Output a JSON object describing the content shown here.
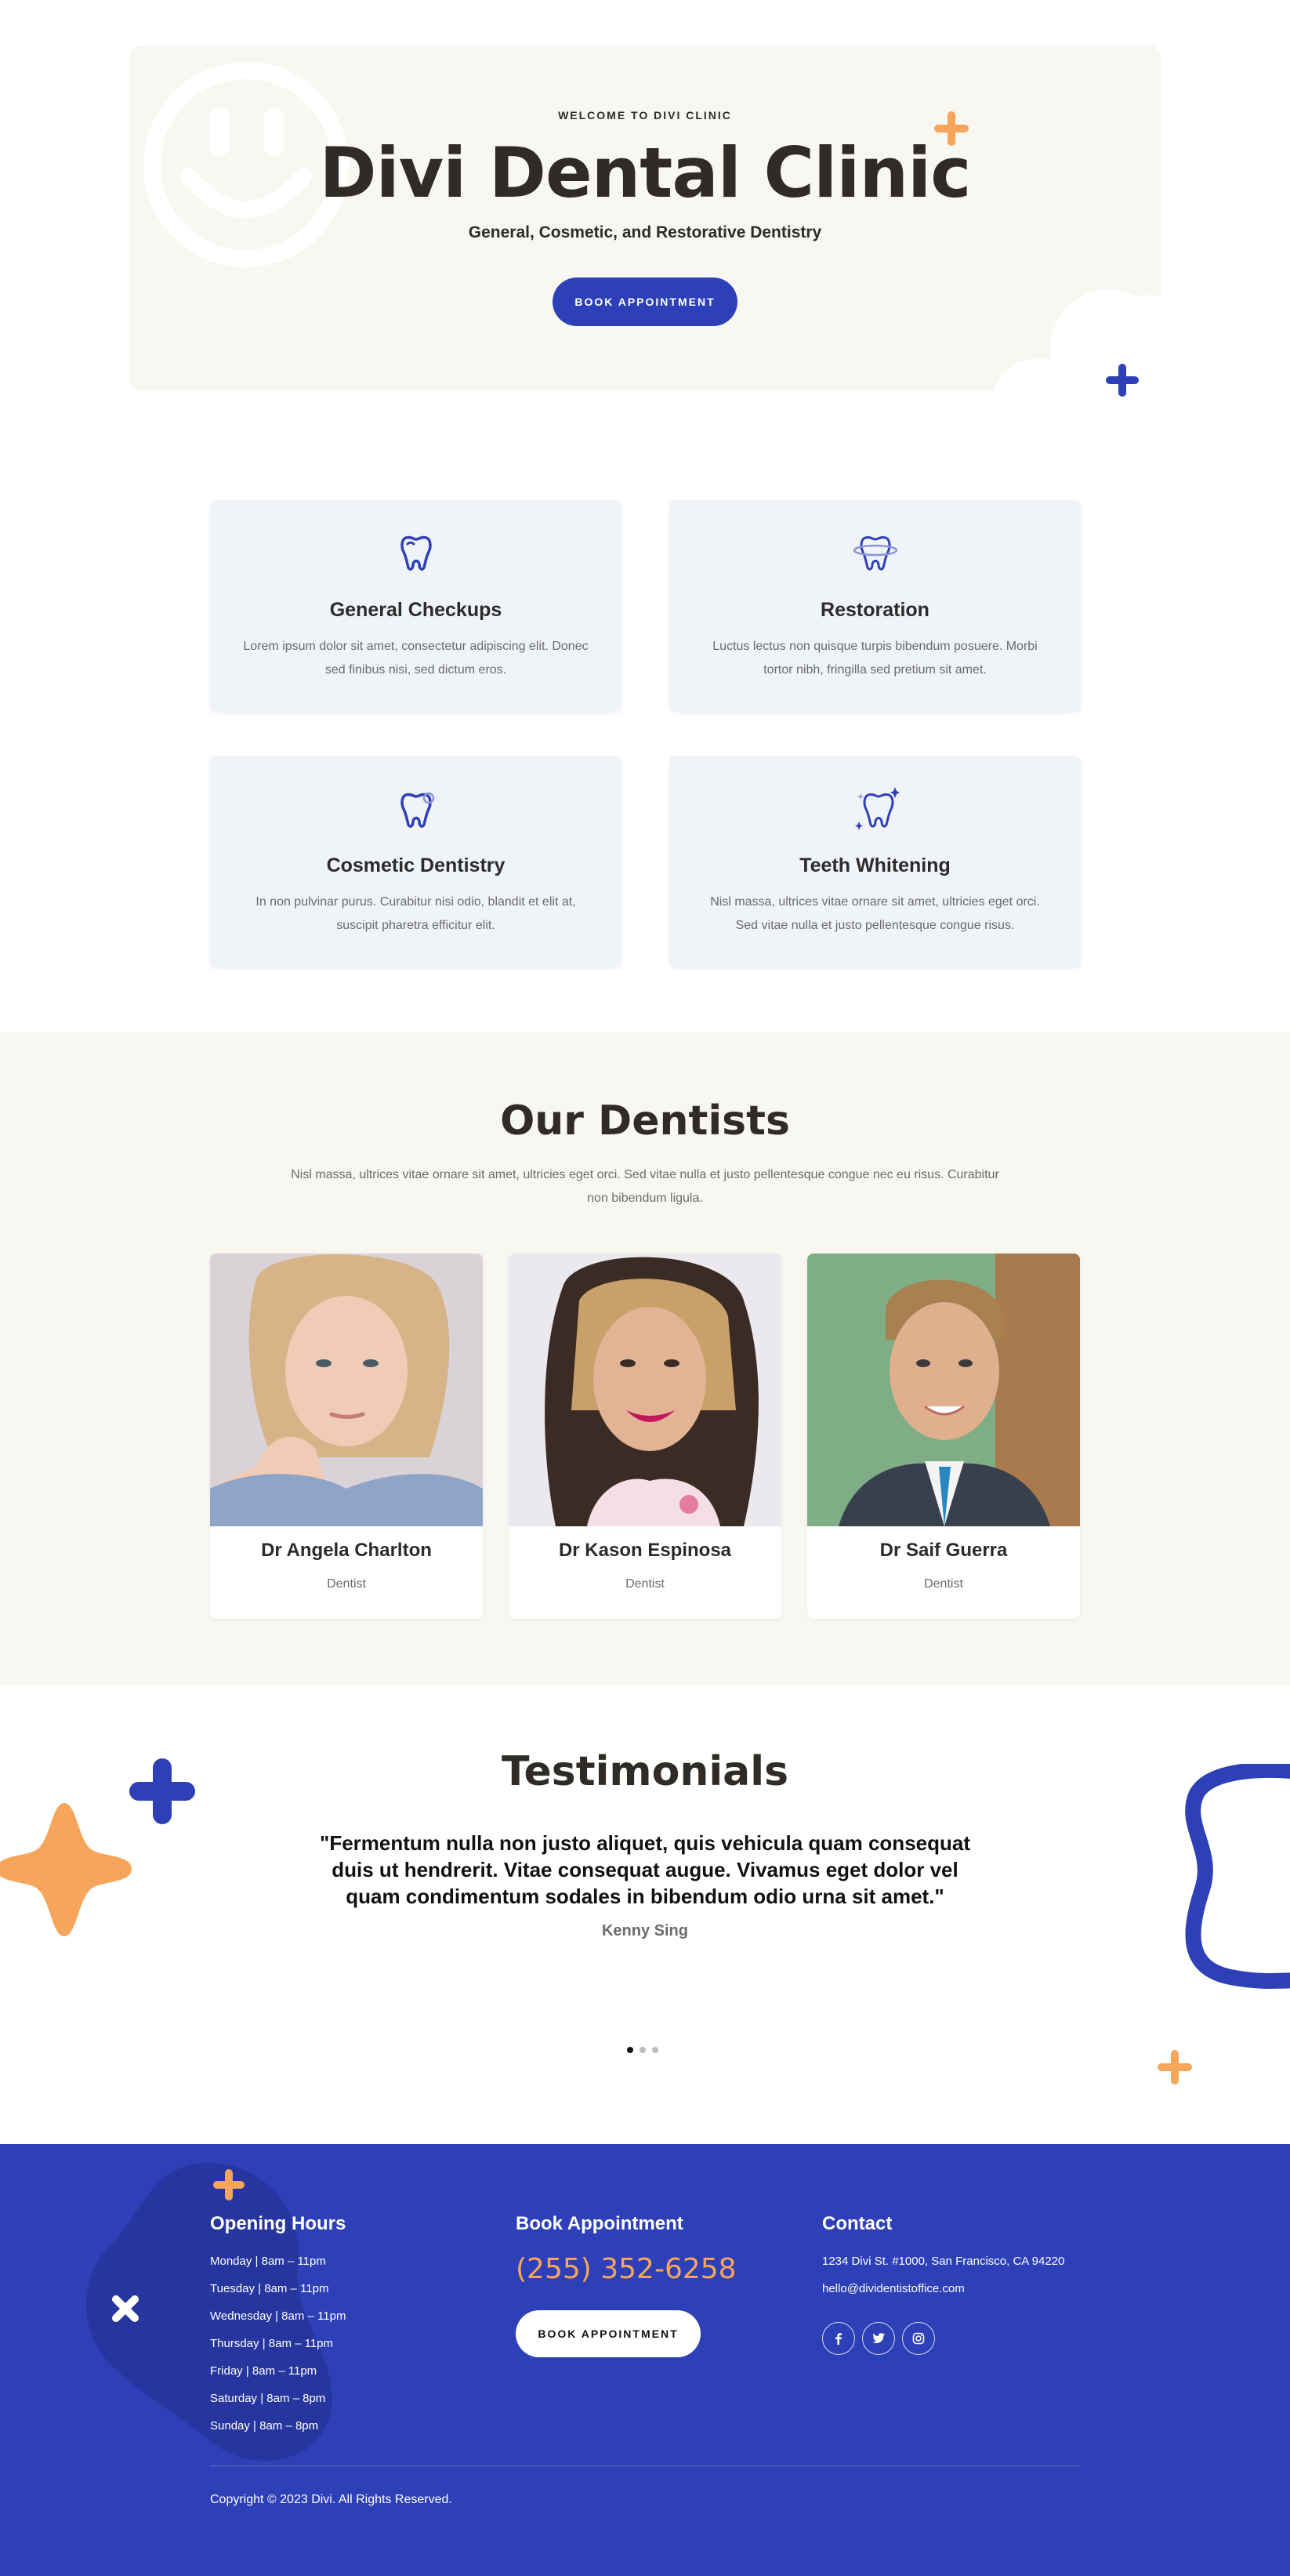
{
  "hero": {
    "eyebrow": "WELCOME TO DIVI CLINIC",
    "title": "Divi Dental Clinic",
    "subtitle": "General, Cosmetic, and Restorative Dentistry",
    "cta_label": "BOOK APPOINTMENT"
  },
  "services": [
    {
      "icon": "tooth-icon",
      "title": "General Checkups",
      "desc": "Lorem ipsum dolor sit amet, consectetur adipiscing elit. Donec sed finibus nisi, sed dictum eros."
    },
    {
      "icon": "tooth-restoration-icon",
      "title": "Restoration",
      "desc": "Luctus lectus non quisque turpis bibendum posuere. Morbi tortor nibh, fringilla sed pretium sit amet."
    },
    {
      "icon": "tooth-cosmetic-icon",
      "title": "Cosmetic Dentistry",
      "desc": "In non pulvinar purus. Curabitur nisi odio, blandit et elit at, suscipit pharetra efficitur elit."
    },
    {
      "icon": "tooth-sparkle-icon",
      "title": "Teeth Whitening",
      "desc": "Nisl massa, ultrices vitae ornare sit amet, ultricies eget orci. Sed vitae nulla et justo pellentesque congue risus."
    }
  ],
  "dentists": {
    "title": "Our Dentists",
    "desc": "Nisl massa, ultrices vitae ornare sit amet, ultricies eget orci. Sed vitae nulla et justo pellentesque congue nec eu risus. Curabitur non bibendum ligula.",
    "items": [
      {
        "name": "Dr Angela Charlton",
        "role": "Dentist"
      },
      {
        "name": "Dr Kason Espinosa",
        "role": "Dentist"
      },
      {
        "name": "Dr Saif Guerra",
        "role": "Dentist"
      }
    ]
  },
  "testimonials": {
    "title": "Testimonials",
    "quote": "\"Fermentum nulla non justo aliquet, quis vehicula quam consequat duis ut hendrerit. Vitae consequat augue. Vivamus eget dolor vel quam condimentum sodales in bibendum odio urna sit amet.\"",
    "author": "Kenny Sing"
  },
  "footer": {
    "hours_title": "Opening Hours",
    "hours": [
      "Monday | 8am – 11pm",
      "Tuesday | 8am – 11pm",
      "Wednesday | 8am – 11pm",
      "Thursday | 8am – 11pm",
      "Friday | 8am – 11pm",
      "Saturday | 8am – 8pm",
      "Sunday | 8am – 8pm"
    ],
    "book_title": "Book Appointment",
    "phone": "(255) 352-6258",
    "book_label": "BOOK APPOINTMENT",
    "contact_title": "Contact",
    "address": "1234 Divi St. #1000, San Francisco, CA 94220",
    "email": "hello@dividentistoffice.com",
    "social_icons": [
      "facebook-icon",
      "twitter-icon",
      "instagram-icon"
    ],
    "copyright": "Copyright © 2023 Divi. All Rights Reserved."
  },
  "colors": {
    "brand_blue": "#2e40b8",
    "accent_orange": "#f7a55a",
    "cream": "#f9f7f1",
    "card_blue": "#f0f3f8"
  }
}
